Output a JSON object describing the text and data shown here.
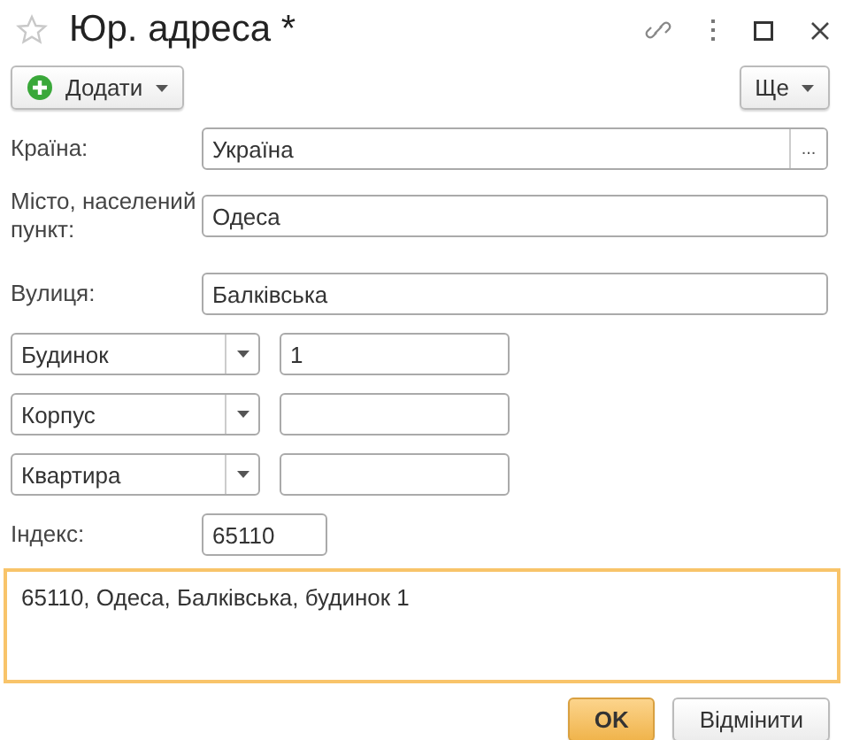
{
  "window": {
    "title": "Юр. адреса *"
  },
  "toolbar": {
    "add_button": "Додати",
    "more_button": "Ще"
  },
  "fields": [
    {
      "label": "Країна:",
      "value": "Україна",
      "kind": "choice",
      "choice_button": "..."
    },
    {
      "label": "Місто, населений пункт:",
      "value": "Одеса",
      "kind": "text"
    },
    {
      "label": "Вулиця:",
      "value": "Балківська",
      "kind": "text"
    }
  ],
  "house_parts": [
    {
      "type": "Будинок",
      "value": "1"
    },
    {
      "type": "Корпус"
    },
    {
      "type": "Квартира"
    }
  ],
  "postcode": {
    "label": "Індекс:",
    "value": "65110"
  },
  "presentation": {
    "value": "65110, Одеса, Балківська, будинок 1",
    "focused": true
  },
  "buttons": [
    {
      "label": "OK",
      "default": true
    },
    {
      "label": "Відмінити",
      "default": false
    }
  ]
}
